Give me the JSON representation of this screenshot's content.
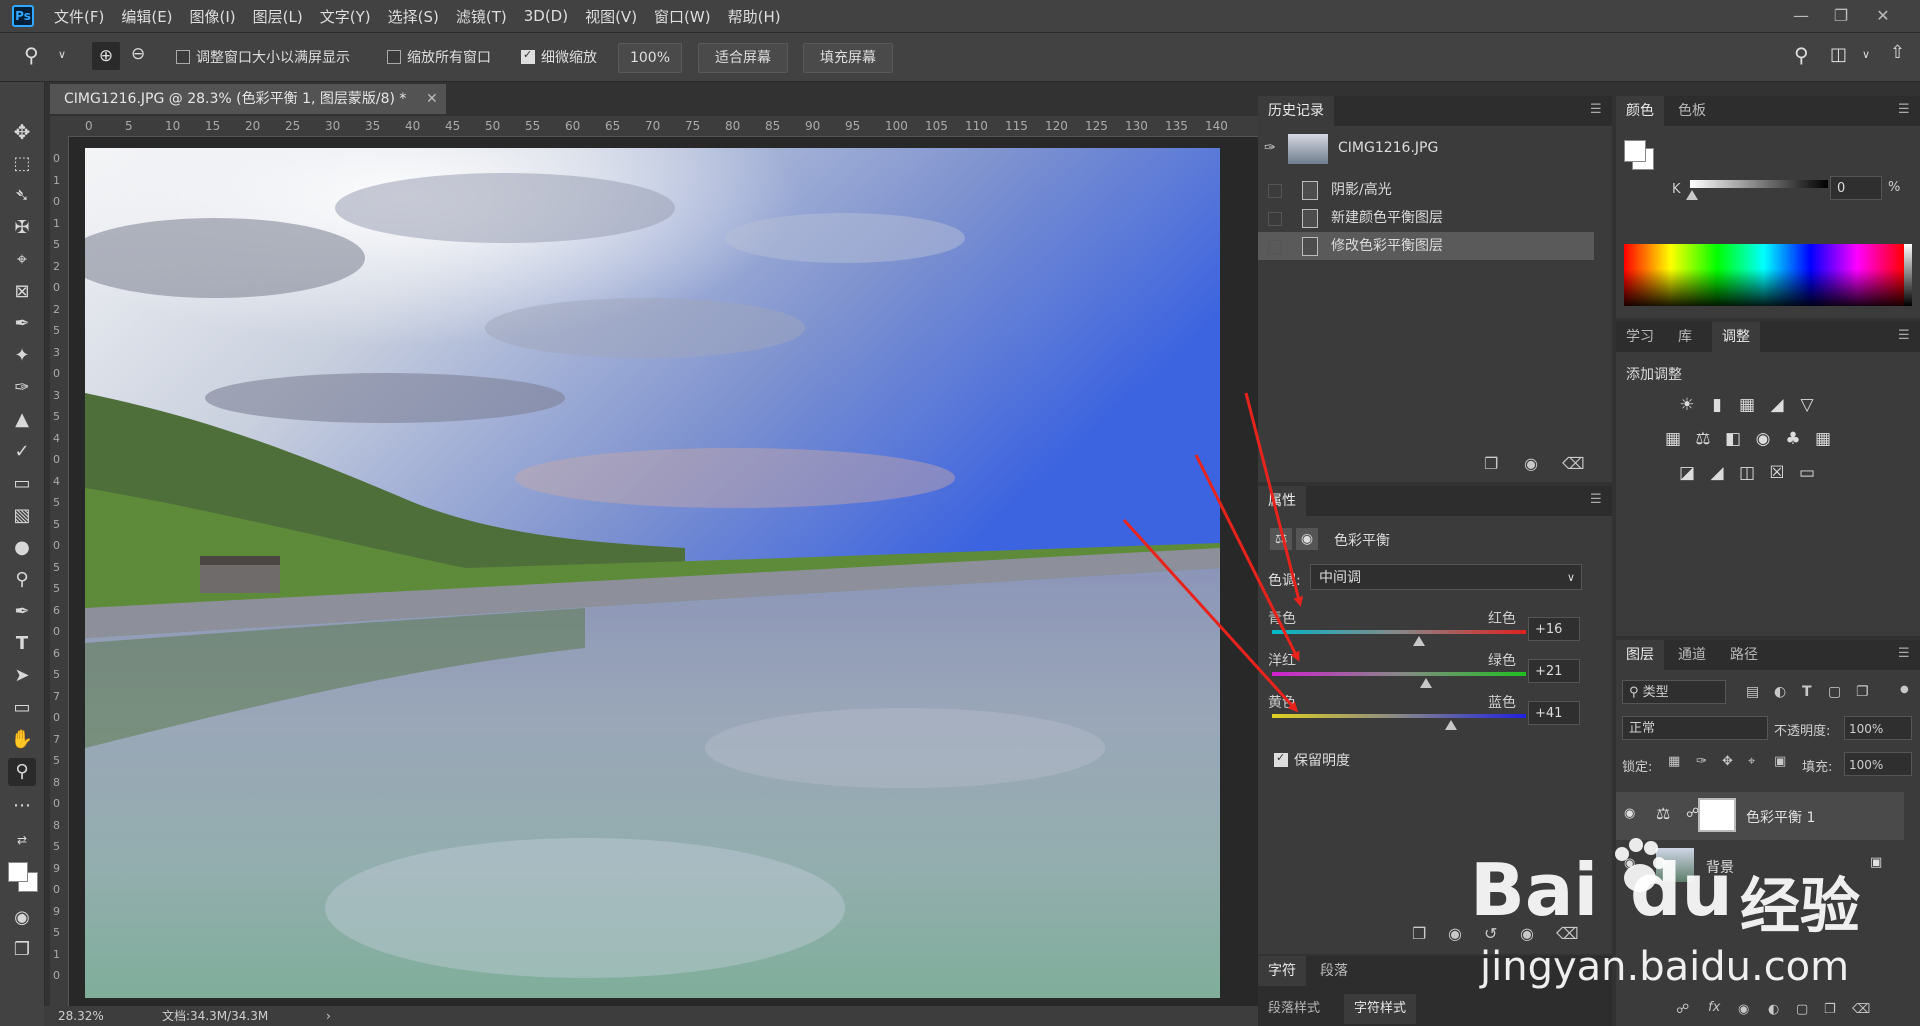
{
  "app": {
    "logo": "Ps"
  },
  "menu": [
    "文件(F)",
    "编辑(E)",
    "图像(I)",
    "图层(L)",
    "文字(Y)",
    "选择(S)",
    "滤镜(T)",
    "3D(D)",
    "视图(V)",
    "窗口(W)",
    "帮助(H)"
  ],
  "options": {
    "resize_windows": "调整窗口大小以满屏显示",
    "zoom_all": "缩放所有窗口",
    "scrubby_zoom": "细微缩放",
    "zoom_value": "100%",
    "fit_screen": "适合屏幕",
    "fill_screen": "填充屏幕"
  },
  "document": {
    "tab_title": "CIMG1216.JPG @ 28.3% (色彩平衡 1, 图层蒙版/8) *",
    "ruler_h": [
      "0",
      "5",
      "10",
      "15",
      "20",
      "25",
      "30",
      "35",
      "40",
      "45",
      "50",
      "55",
      "60",
      "65",
      "70",
      "75",
      "80",
      "85",
      "90",
      "95",
      "100",
      "105",
      "110",
      "115",
      "120",
      "125",
      "130",
      "135",
      "140"
    ],
    "ruler_v": [
      "0",
      "1",
      "0",
      "1",
      "5",
      "2",
      "0",
      "2",
      "5",
      "3",
      "0",
      "3",
      "5",
      "4",
      "0",
      "4",
      "5",
      "5",
      "0",
      "5",
      "5",
      "6",
      "0",
      "6",
      "5",
      "7",
      "0",
      "7",
      "5",
      "8",
      "0",
      "8",
      "5",
      "9",
      "0",
      "9",
      "5",
      "1",
      "0"
    ],
    "zoom": "28.32%",
    "doc_size": "文档:34.3M/34.3M"
  },
  "history": {
    "tab": "历史记录",
    "snapshot": "CIMG1216.JPG",
    "items": [
      "阴影/高光",
      "新建颜色平衡图层",
      "修改色彩平衡图层"
    ]
  },
  "color_panel": {
    "tabs": [
      "颜色",
      "色板"
    ],
    "channel": "K",
    "value": "0",
    "unit": "%"
  },
  "adjustments": {
    "tabs": [
      "学习",
      "库",
      "调整"
    ],
    "add_label": "添加调整"
  },
  "properties": {
    "tab": "属性",
    "title": "色彩平衡",
    "tone_label": "色调:",
    "tone_value": "中间调",
    "sliders": [
      {
        "left": "青色",
        "right": "红色",
        "value": "+16",
        "level": 16
      },
      {
        "left": "洋红",
        "right": "绿色",
        "value": "+21",
        "level": 21
      },
      {
        "left": "黄色",
        "right": "蓝色",
        "value": "+41",
        "level": 41
      }
    ],
    "preserve": "保留明度"
  },
  "char_panel": {
    "tabs": [
      "字符",
      "段落"
    ],
    "style_tabs": [
      "段落样式",
      "字符样式"
    ]
  },
  "layers": {
    "tabs": [
      "图层",
      "通道",
      "路径"
    ],
    "filter": "类型",
    "blend": "正常",
    "opacity_label": "不透明度:",
    "opacity": "100%",
    "lock_label": "锁定:",
    "fill_label": "填充:",
    "fill": "100%",
    "items": [
      "色彩平衡 1",
      "背景"
    ]
  },
  "watermark": {
    "brand": "Bai",
    "brand2": "du",
    "brand3": "经验",
    "url": "jingyan.baidu.com"
  },
  "colors": {
    "accent": "#31a8ff",
    "arrow": "#e8231c"
  }
}
